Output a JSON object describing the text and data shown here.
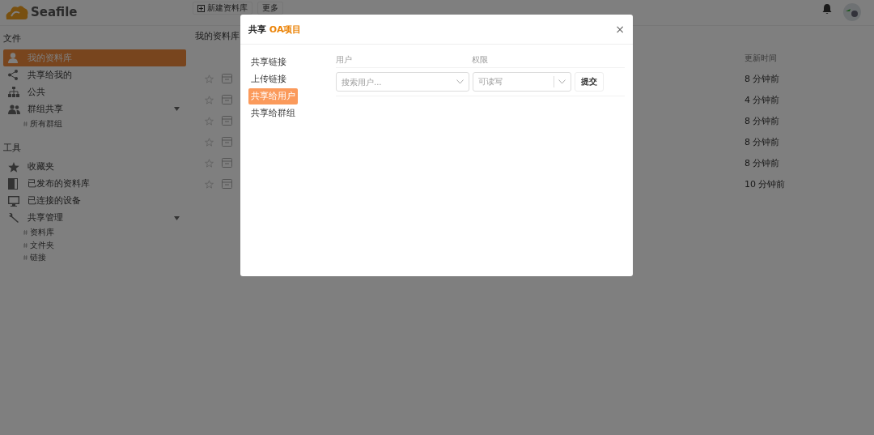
{
  "header": {
    "logo_text": "Seafile",
    "toolbar": [
      {
        "kind": "new",
        "label": "新建资料库"
      },
      {
        "kind": "more",
        "label": "更多"
      }
    ]
  },
  "sidebar": {
    "sections": [
      {
        "title": "文件",
        "items": [
          {
            "label": "我的资料库",
            "selected": true
          },
          {
            "label": "共享给我的",
            "selected": false
          },
          {
            "label": "公共",
            "selected": false
          },
          {
            "label": "群组共享",
            "selected": false,
            "expanded": true,
            "children": [
              {
                "label": "所有群组"
              }
            ]
          }
        ]
      },
      {
        "title": "工具",
        "items": [
          {
            "label": "收藏夹",
            "selected": false
          },
          {
            "label": "已发布的资料库",
            "selected": false
          },
          {
            "label": "已连接的设备",
            "selected": false
          },
          {
            "label": "共享管理",
            "selected": false,
            "expanded": true,
            "children": [
              {
                "label": "资料库"
              },
              {
                "label": "文件夹"
              },
              {
                "label": "链接"
              }
            ]
          }
        ]
      }
    ]
  },
  "main": {
    "title": "我的资料库",
    "columns": {
      "modified": "更新时间"
    },
    "rows": [
      {
        "starred": false,
        "modified": "8 分钟前"
      },
      {
        "starred": false,
        "modified": "4 分钟前"
      },
      {
        "starred": false,
        "modified": "8 分钟前"
      },
      {
        "starred": false,
        "modified": "8 分钟前"
      },
      {
        "starred": false,
        "modified": "8 分钟前"
      },
      {
        "starred": false,
        "modified": "10 分钟前"
      }
    ]
  },
  "dialog": {
    "title": "共享",
    "title_highlight": "OA项目",
    "close": "×",
    "tabs": [
      {
        "label": "共享链接",
        "selected": false
      },
      {
        "label": "上传链接",
        "selected": false
      },
      {
        "label": "共享给用户",
        "selected": true
      },
      {
        "label": "共享给群组",
        "selected": false
      }
    ],
    "form": {
      "user_label": "用户",
      "permission_label": "权限",
      "user_field": {
        "placeholder": "搜索用户..."
      },
      "permission_select": {
        "value": "可读写"
      },
      "submit": "提交"
    }
  }
}
